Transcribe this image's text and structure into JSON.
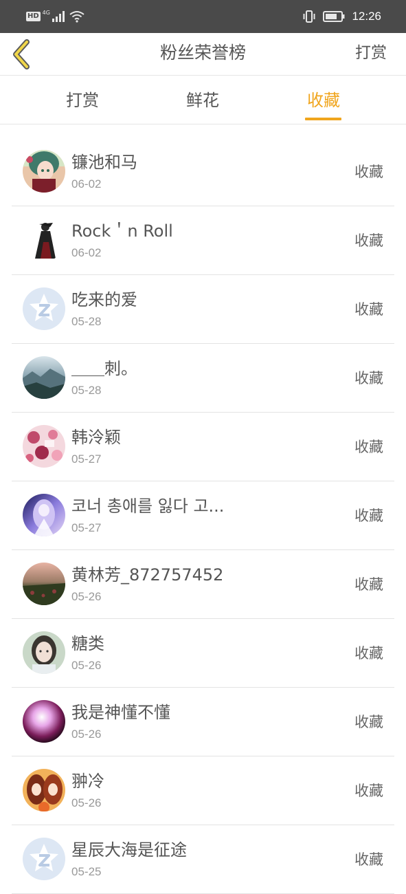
{
  "status_bar": {
    "network_badge": "HD",
    "network_type": "4G",
    "time": "12:26",
    "icons": [
      "signal-icon",
      "wifi-icon",
      "vibrate-icon",
      "battery-icon"
    ]
  },
  "header": {
    "title": "粉丝荣誉榜",
    "right_action": "打赏",
    "back_icon": "chevron-left-icon",
    "accent_color": "#f0a51d"
  },
  "tabs": [
    {
      "label": "打赏",
      "active": false
    },
    {
      "label": "鲜花",
      "active": false
    },
    {
      "label": "收藏",
      "active": true
    }
  ],
  "list": [
    {
      "name": "镰池和马",
      "date": "06-02",
      "action": "收藏",
      "avatar": "anime-girl"
    },
    {
      "name": "Rock＇n Roll",
      "date": "06-02",
      "action": "收藏",
      "avatar": "dark-figure"
    },
    {
      "name": "吃来的爱",
      "date": "05-28",
      "action": "收藏",
      "avatar": "default-qq"
    },
    {
      "name": "＿＿刺。",
      "date": "05-28",
      "action": "收藏",
      "avatar": "landscape"
    },
    {
      "name": "韩泠颖",
      "date": "05-27",
      "action": "收藏",
      "avatar": "pink-art"
    },
    {
      "name": "코너 총애를 잃다 고...",
      "date": "05-27",
      "action": "收藏",
      "avatar": "purple-anime"
    },
    {
      "name": "黄林芳_872757452",
      "date": "05-26",
      "action": "收藏",
      "avatar": "sunset-field"
    },
    {
      "name": "糖类",
      "date": "05-26",
      "action": "收藏",
      "avatar": "girl-photo"
    },
    {
      "name": "我是神懂不懂",
      "date": "05-26",
      "action": "收藏",
      "avatar": "magenta-glow"
    },
    {
      "name": "翀冷",
      "date": "05-26",
      "action": "收藏",
      "avatar": "orange-anime"
    },
    {
      "name": "星辰大海是征途",
      "date": "05-25",
      "action": "收藏",
      "avatar": "default-qq"
    }
  ]
}
